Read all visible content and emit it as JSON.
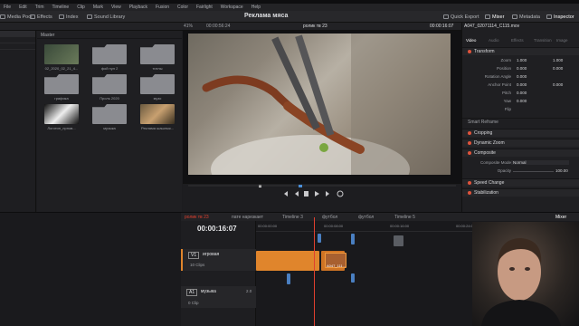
{
  "menu": [
    "File",
    "Edit",
    "Trim",
    "Timeline",
    "Clip",
    "Mark",
    "View",
    "Playback",
    "Fusion",
    "Color",
    "Fairlight",
    "Workspace",
    "Help"
  ],
  "toolbar": {
    "media_pool": "Media Pool",
    "effects": "Effects",
    "index": "Index",
    "sound_library": "Sound Library",
    "project_title": "Реклама мяса",
    "quick_export": "Quick Export",
    "mixer": "Mixer",
    "metadata": "Metadata",
    "inspector": "Inspector"
  },
  "viewer": {
    "zoom": "41%",
    "timecode_left": "00:00:56:24",
    "timeline_name": "ролик тв 23",
    "timecode_right": "00:00:16:07"
  },
  "media_pool": {
    "bin": "Master",
    "clips": [
      {
        "label": "02_2020_02_21_4...",
        "kind": "video"
      },
      {
        "label": "фой пул 2",
        "kind": "folder"
      },
      {
        "label": "титлы",
        "kind": "folder"
      },
      {
        "label": "графика",
        "kind": "folder"
      },
      {
        "label": "Проль 2020",
        "kind": "folder"
      },
      {
        "label": "музо",
        "kind": "folder"
      },
      {
        "label": "Логотип_лрнов...",
        "kind": "video"
      },
      {
        "label": "музыка",
        "kind": "folder"
      },
      {
        "label": "Реклама шашлык...",
        "kind": "video"
      }
    ]
  },
  "inspector": {
    "clip_name": "A047_02071114_C115.mov",
    "tabs": [
      "Video",
      "Audio",
      "Effects",
      "Transition",
      "Image"
    ],
    "transform": "Transform",
    "params": [
      {
        "label": "Zoom",
        "x": "1.000",
        "y": "1.000"
      },
      {
        "label": "Position",
        "x": "0.000",
        "y": "0.000"
      },
      {
        "label": "Rotation Angle",
        "x": "0.000",
        "y": ""
      },
      {
        "label": "Anchor Point",
        "x": "0.000",
        "y": "0.000"
      },
      {
        "label": "Pitch",
        "x": "0.000",
        "y": ""
      },
      {
        "label": "Yaw",
        "x": "0.000",
        "y": ""
      },
      {
        "label": "Flip",
        "x": "",
        "y": ""
      }
    ],
    "smart_reframe": "Smart Reframe",
    "cropping": "Cropping",
    "dynamic_zoom": "Dynamic Zoom",
    "composite": "Composite",
    "composite_mode_label": "Composite Mode",
    "composite_mode_value": "Normal",
    "opacity_label": "Opacity",
    "opacity_value": "100.00",
    "speed_change": "Speed Change",
    "stabilization": "Stabilization"
  },
  "timeline": {
    "tabs": [
      "ролик тв 23",
      "пате нарезкает",
      "Timeline 3",
      "футбол",
      "футбол",
      "Timeline 5"
    ],
    "mixer": "Mixer",
    "timecode": "00:00:16:07",
    "ruler": [
      "00:00:00:00",
      "00:00:08:00",
      "00:00:16:00",
      "00:00:24:00",
      "00:00:32:00",
      "00:00:40:00",
      "00:00:48:00"
    ],
    "v1": {
      "id": "V1",
      "name": "игровая",
      "clips_count": "10 Clips"
    },
    "a1": {
      "id": "A1",
      "name": "музыка",
      "level": "2.0",
      "clips_count": "0 Clip"
    },
    "clip_label": "A047_111..."
  },
  "colors": {
    "accent": "#e0402f",
    "clip_orange": "#e0852c",
    "clip_blue": "#4a7fc1"
  }
}
